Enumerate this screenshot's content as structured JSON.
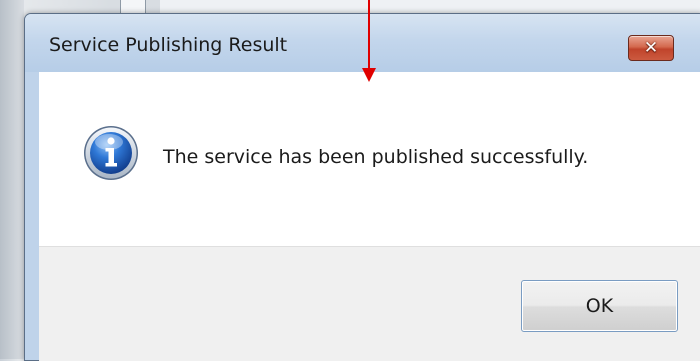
{
  "dialog": {
    "title": "Service Publishing Result",
    "close_glyph": "✕",
    "close_icon": "close-icon",
    "message_icon": "information-icon",
    "message": "The service has been published successfully.",
    "ok_label": "OK"
  },
  "annotation": {
    "arrow_color": "#e00000"
  },
  "colors": {
    "titlebar": "#c3d6ec",
    "close_button": "#c0442b",
    "content_background": "#ffffff",
    "footer_background": "#f0f0f0",
    "info_icon": "#1f5fb8"
  }
}
